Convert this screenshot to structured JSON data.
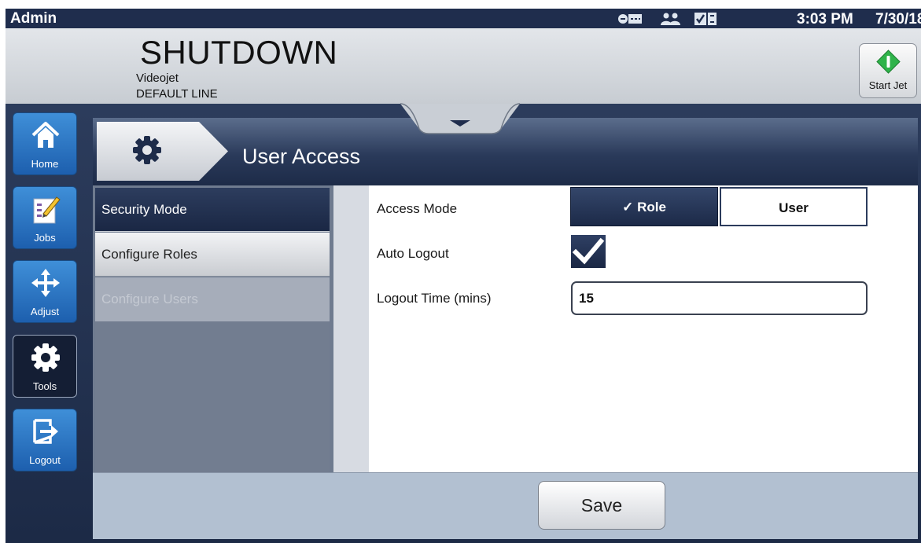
{
  "status_bar": {
    "user": "Admin",
    "time": "3:03 PM",
    "date": "7/30/18",
    "icons": [
      "network-icon",
      "users-icon",
      "checklist-icon"
    ]
  },
  "header": {
    "printer_state": "SHUTDOWN",
    "device_name": "Videojet",
    "line_name": "DEFAULT LINE",
    "start_jet_label": "Start Jet"
  },
  "sidebar": {
    "items": [
      {
        "label": "Home",
        "icon": "home-icon",
        "active": false
      },
      {
        "label": "Jobs",
        "icon": "jobs-icon",
        "active": false
      },
      {
        "label": "Adjust",
        "icon": "move-icon",
        "active": false
      },
      {
        "label": "Tools",
        "icon": "gear-icon",
        "active": true
      },
      {
        "label": "Logout",
        "icon": "logout-icon",
        "active": false
      }
    ]
  },
  "page": {
    "title": "User Access",
    "title_icon": "gear-icon"
  },
  "left_menu": {
    "items": [
      {
        "label": "Security Mode",
        "state": "selected"
      },
      {
        "label": "Configure Roles",
        "state": "normal"
      },
      {
        "label": "Configure Users",
        "state": "disabled"
      }
    ]
  },
  "form": {
    "access_mode": {
      "label": "Access Mode",
      "options": [
        "Role",
        "User"
      ],
      "selected": "Role"
    },
    "auto_logout": {
      "label": "Auto Logout",
      "checked": true
    },
    "logout_time": {
      "label": "Logout Time (mins)",
      "value": "15"
    }
  },
  "footer": {
    "save_label": "Save"
  },
  "colors": {
    "navy": "#1f2d4d",
    "button_blue": "#2a7bd0",
    "start_green": "#2fb34a"
  }
}
